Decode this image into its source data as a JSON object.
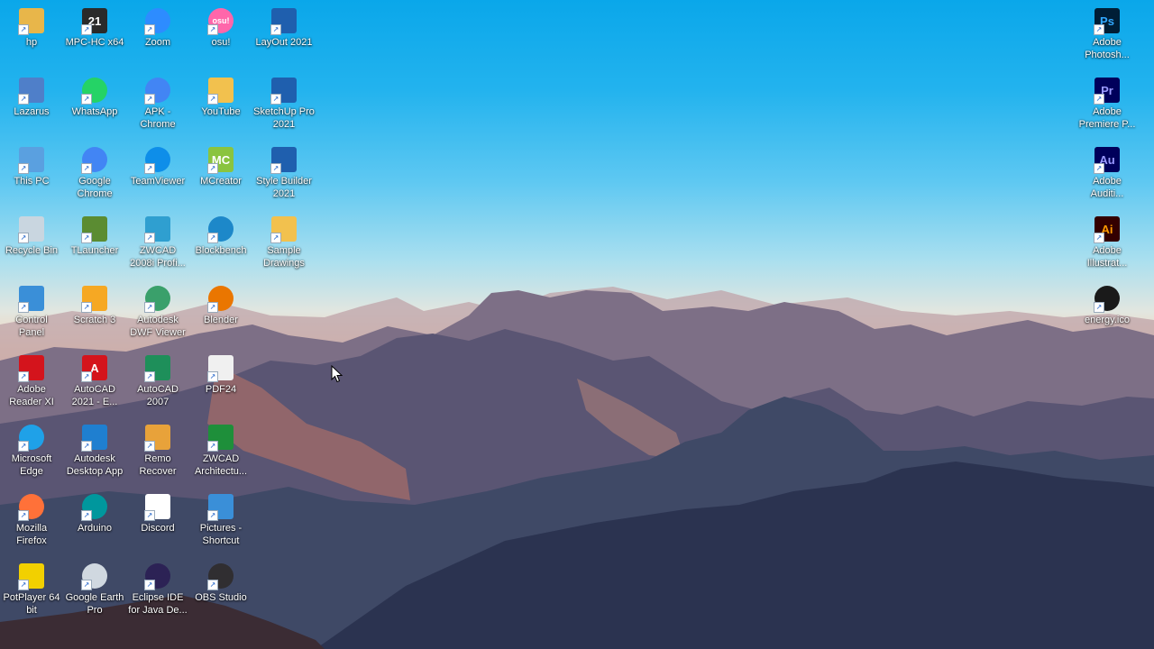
{
  "desktop": {
    "left_icons": [
      {
        "name": "hp",
        "label": "hp",
        "icon": "user-folder-icon",
        "color": "#e8b64a"
      },
      {
        "name": "mpc-hc-x64",
        "label": "MPC-HC x64",
        "icon": "clapperboard-icon",
        "color": "#2a2a2a",
        "glyph_text": "21"
      },
      {
        "name": "zoom",
        "label": "Zoom",
        "icon": "zoom-camera-icon",
        "color": "#2d8cff"
      },
      {
        "name": "osu",
        "label": "osu!",
        "icon": "osu-icon",
        "color": "#ff66aa",
        "glyph_text": "osu!"
      },
      {
        "name": "layout-2021",
        "label": "LayOut 2021",
        "icon": "layout-icon",
        "color": "#1f5fae"
      },
      {
        "name": "lazarus",
        "label": "Lazarus",
        "icon": "lazarus-icon",
        "color": "#4f7fc9"
      },
      {
        "name": "whatsapp",
        "label": "WhatsApp",
        "icon": "whatsapp-icon",
        "color": "#25d366"
      },
      {
        "name": "apk-chrome",
        "label": "APK -\nChrome",
        "icon": "chrome-apk-icon",
        "color": "#4285f4"
      },
      {
        "name": "youtube",
        "label": "YouTube",
        "icon": "folder-icon",
        "color": "#f2c14e"
      },
      {
        "name": "sketchup-pro-2021",
        "label": "SketchUp Pro\n2021",
        "icon": "sketchup-icon",
        "color": "#1f5fae"
      },
      {
        "name": "this-pc",
        "label": "This PC",
        "icon": "monitor-icon",
        "color": "#5aa0e0"
      },
      {
        "name": "google-chrome",
        "label": "Google\nChrome",
        "icon": "chrome-icon",
        "color": "#4285f4"
      },
      {
        "name": "teamviewer",
        "label": "TeamViewer",
        "icon": "teamviewer-icon",
        "color": "#0e8ee9"
      },
      {
        "name": "mcreator",
        "label": "MCreator",
        "icon": "mcreator-icon",
        "color": "#8ac43f",
        "glyph_text": "MC"
      },
      {
        "name": "style-builder-2021",
        "label": "Style Builder\n2021",
        "icon": "style-builder-icon",
        "color": "#1f5fae"
      },
      {
        "name": "recycle-bin",
        "label": "Recycle Bin",
        "icon": "recycle-bin-icon",
        "color": "#c9d6e0"
      },
      {
        "name": "tlauncher",
        "label": "TLauncher",
        "icon": "grass-block-icon",
        "color": "#5b8c32"
      },
      {
        "name": "zwcad-2008",
        "label": "ZWCAD\n2008i Profi...",
        "icon": "zwcad-icon",
        "color": "#2f9fd0"
      },
      {
        "name": "blockbench",
        "label": "Blockbench",
        "icon": "blockbench-icon",
        "color": "#1d88c9"
      },
      {
        "name": "sample-drawings",
        "label": "Sample\nDrawings",
        "icon": "document-folder-icon",
        "color": "#f2c14e"
      },
      {
        "name": "control-panel",
        "label": "Control\nPanel",
        "icon": "control-panel-icon",
        "color": "#3a8fd8"
      },
      {
        "name": "scratch-3",
        "label": "Scratch 3",
        "icon": "scratch-icon",
        "color": "#f6a823"
      },
      {
        "name": "autodesk-dwf-viewer",
        "label": "Autodesk\nDWF Viewer",
        "icon": "globe-icon",
        "color": "#3aa06b"
      },
      {
        "name": "blender",
        "label": "Blender",
        "icon": "blender-icon",
        "color": "#ea7600"
      },
      {
        "name": "adobe-reader-xi",
        "label": "Adobe\nReader XI",
        "icon": "acrobat-icon",
        "color": "#d4141c"
      },
      {
        "name": "autocad-2021",
        "label": "AutoCAD\n2021 - E...",
        "icon": "autocad-icon",
        "color": "#d4141c",
        "glyph_text": "A"
      },
      {
        "name": "autocad-2007",
        "label": "AutoCAD\n2007",
        "icon": "autocad-2007-icon",
        "color": "#1e8f5a"
      },
      {
        "name": "pdf24",
        "label": "PDF24",
        "icon": "pdf24-icon",
        "color": "#f0f0f0"
      },
      {
        "name": "microsoft-edge",
        "label": "Microsoft\nEdge",
        "icon": "edge-icon",
        "color": "#1fa1e8"
      },
      {
        "name": "autodesk-desktop-app",
        "label": "Autodesk\nDesktop App",
        "icon": "autodesk-icon",
        "color": "#1f7fd0"
      },
      {
        "name": "remo-recover",
        "label": "Remo\nRecover",
        "icon": "remo-icon",
        "color": "#e8a23a"
      },
      {
        "name": "zwcad-architecture",
        "label": "ZWCAD\nArchitectu...",
        "icon": "zwcad-arch-icon",
        "color": "#1e8f3a"
      },
      {
        "name": "mozilla-firefox",
        "label": "Mozilla\nFirefox",
        "icon": "firefox-icon",
        "color": "#ff7139"
      },
      {
        "name": "arduino",
        "label": "Arduino",
        "icon": "arduino-icon",
        "color": "#00979d"
      },
      {
        "name": "discord",
        "label": "Discord",
        "icon": "file-icon",
        "color": "#ffffff"
      },
      {
        "name": "pictures-shortcut",
        "label": "Pictures -\nShortcut",
        "icon": "pictures-icon",
        "color": "#3a8fd8"
      },
      {
        "name": "potplayer-64",
        "label": "PotPlayer 64\nbit",
        "icon": "potplayer-icon",
        "color": "#f2d000"
      },
      {
        "name": "google-earth-pro",
        "label": "Google Earth\nPro",
        "icon": "earth-icon",
        "color": "#d0d8e0"
      },
      {
        "name": "eclipse-ide",
        "label": "Eclipse IDE\nfor Java De...",
        "icon": "eclipse-icon",
        "color": "#2c2255"
      },
      {
        "name": "obs-studio",
        "label": "OBS Studio",
        "icon": "obs-icon",
        "color": "#302e31"
      }
    ],
    "right_icons": [
      {
        "name": "adobe-photoshop",
        "label": "Adobe\nPhotosh...",
        "icon": "photoshop-icon",
        "color": "#001e36",
        "text_color": "#31a8ff",
        "glyph_text": "Ps"
      },
      {
        "name": "adobe-premiere",
        "label": "Adobe\nPremiere P...",
        "icon": "premiere-icon",
        "color": "#00005b",
        "text_color": "#9999ff",
        "glyph_text": "Pr"
      },
      {
        "name": "adobe-audition",
        "label": "Adobe\nAuditi...",
        "icon": "audition-icon",
        "color": "#00005b",
        "text_color": "#9999ff",
        "glyph_text": "Au"
      },
      {
        "name": "adobe-illustrator",
        "label": "Adobe\nIllustrat...",
        "icon": "illustrator-icon",
        "color": "#330000",
        "text_color": "#ff9a00",
        "glyph_text": "Ai"
      },
      {
        "name": "energy-ico",
        "label": "energy.ico",
        "icon": "energy-icon",
        "color": "#1a1a1a"
      }
    ]
  }
}
